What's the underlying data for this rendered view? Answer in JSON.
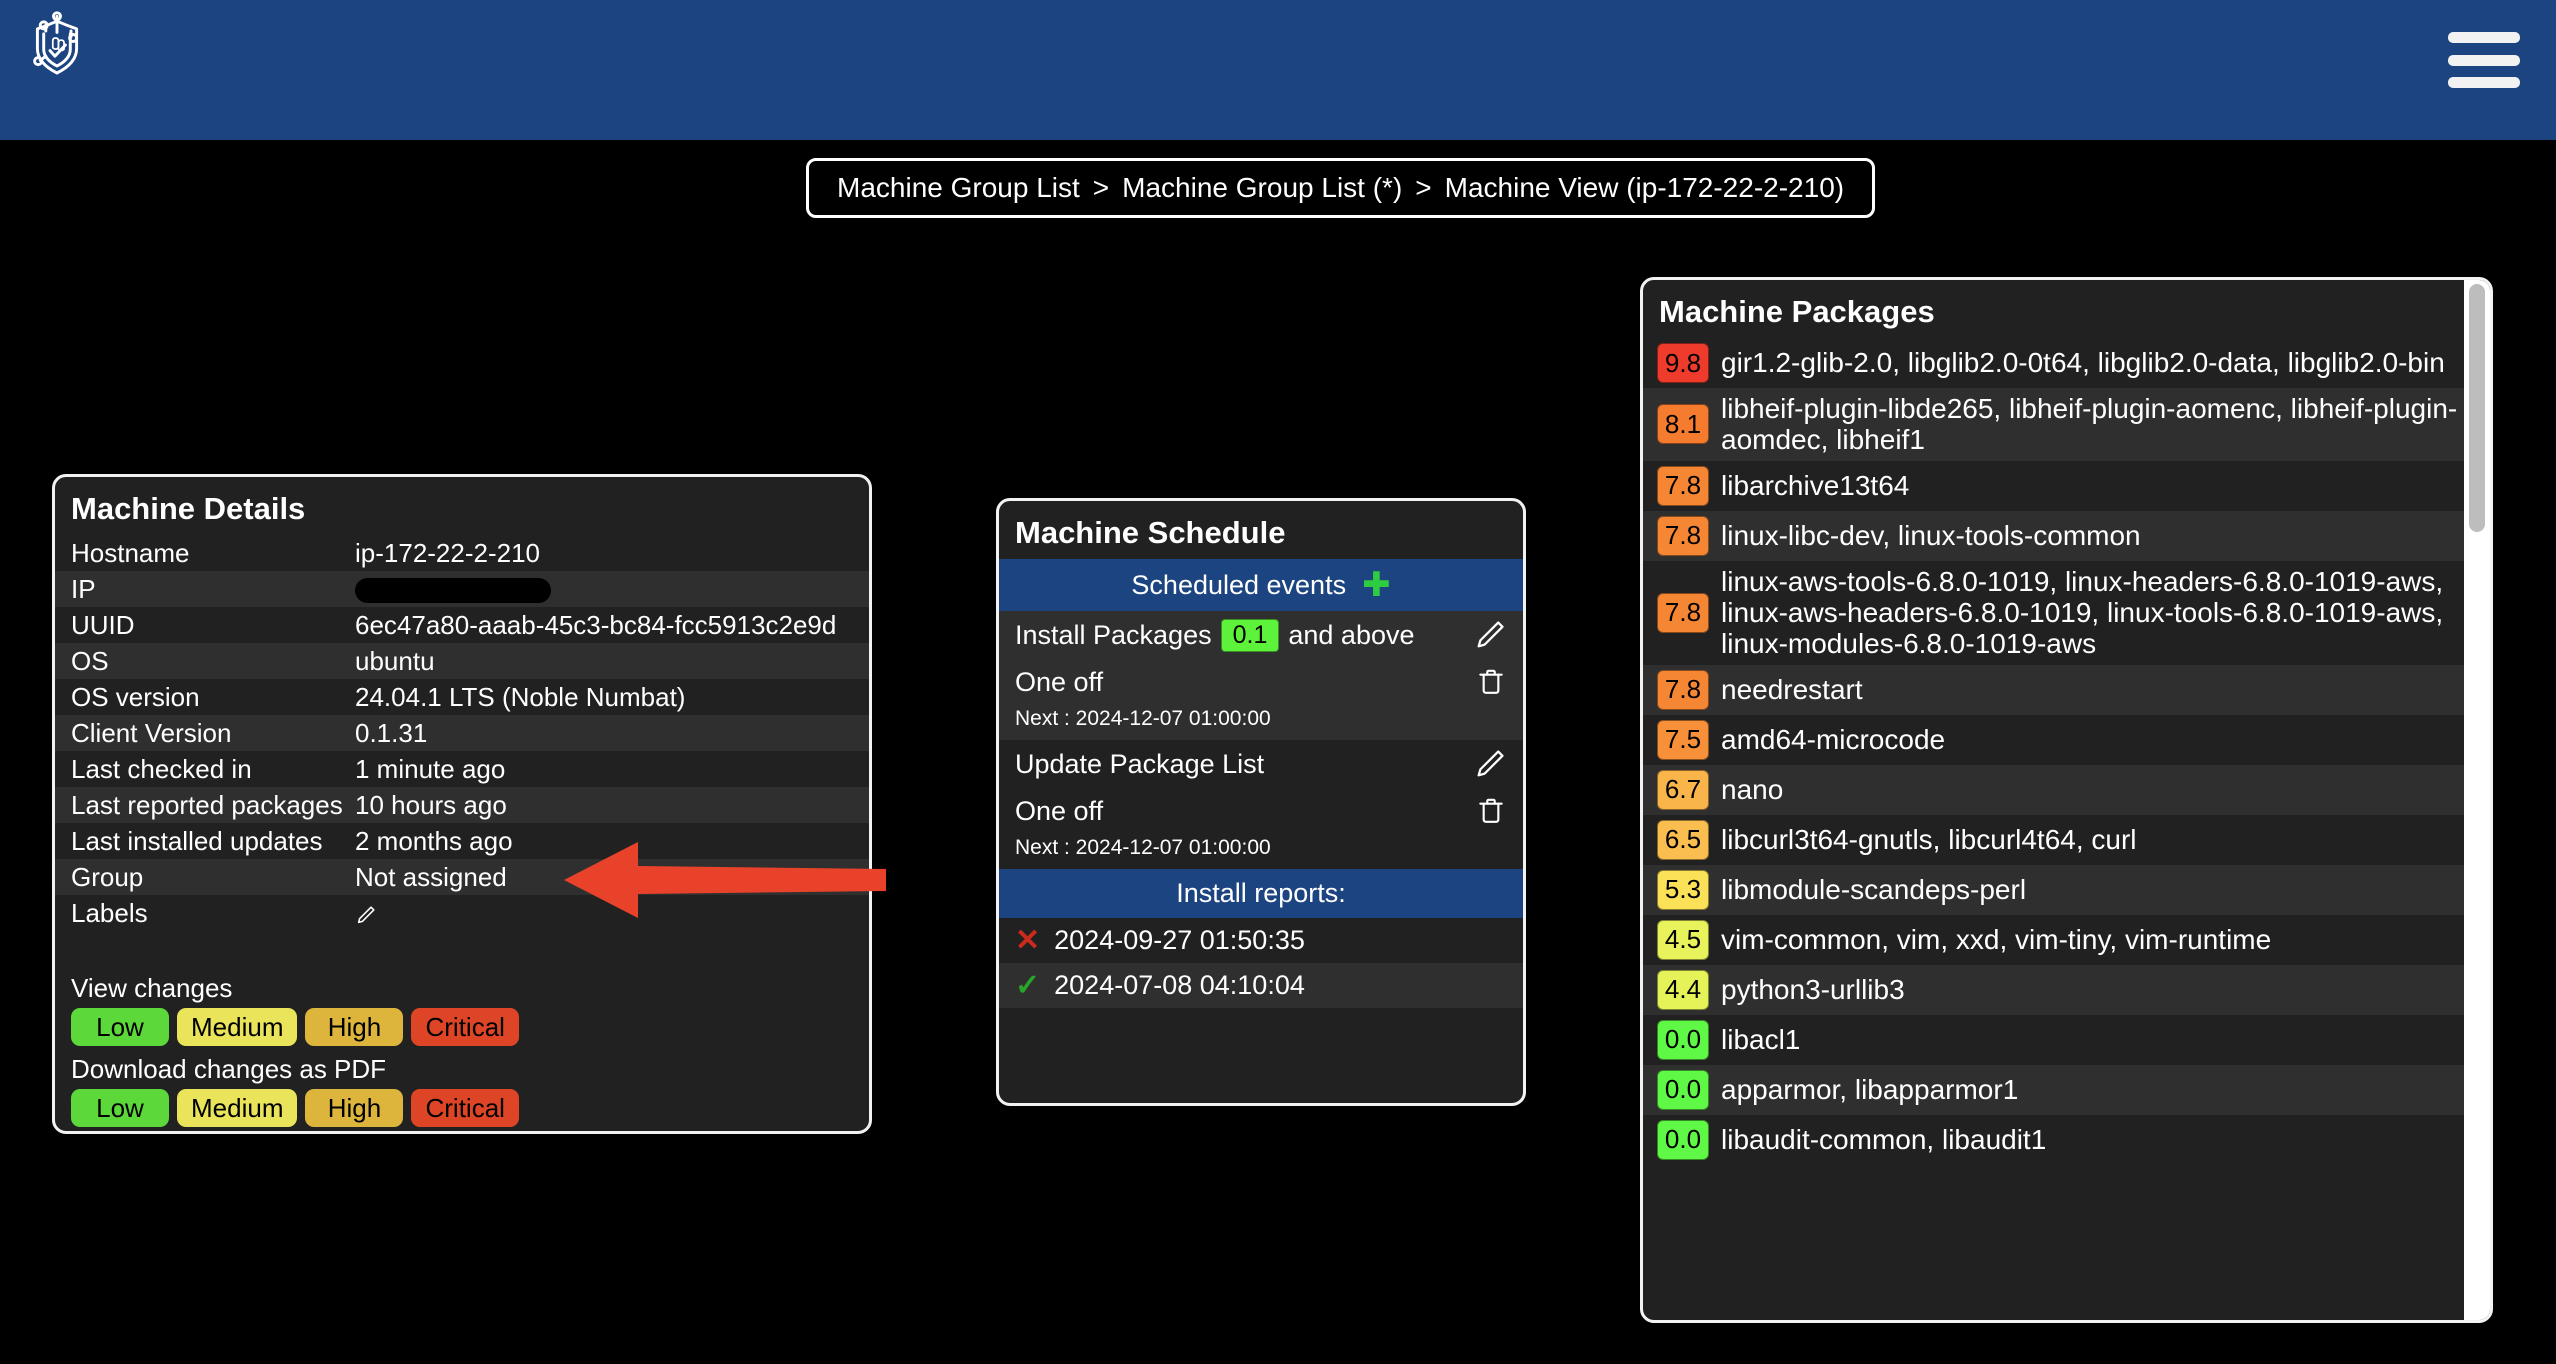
{
  "colors": {
    "header_blue": "#1c4480",
    "card_bg": "#212121",
    "row_alt": "#2f2f2f",
    "accent_red": "#e8432a",
    "green": "#5cf33a",
    "page_bg": "#000000"
  },
  "topbar": {
    "logo_name": "shield-circuit-logo",
    "menu_label": "menu"
  },
  "breadcrumb": {
    "items": [
      {
        "label": "Machine Group List"
      },
      {
        "label": "Machine Group List (*)"
      },
      {
        "label": "Machine View (ip-172-22-2-210)"
      }
    ],
    "separator": ">"
  },
  "machine_details": {
    "title": "Machine Details",
    "rows": [
      {
        "key": "Hostname",
        "value": "ip-172-22-2-210",
        "type": "text"
      },
      {
        "key": "IP",
        "value": "",
        "type": "redacted"
      },
      {
        "key": "UUID",
        "value": "6ec47a80-aaab-45c3-bc84-fcc5913c2e9d",
        "type": "text"
      },
      {
        "key": "OS",
        "value": "ubuntu",
        "type": "text"
      },
      {
        "key": "OS version",
        "value": "24.04.1 LTS (Noble Numbat)",
        "type": "text"
      },
      {
        "key": "Client Version",
        "value": "0.1.31",
        "type": "text"
      },
      {
        "key": "Last checked in",
        "value": "1 minute ago",
        "type": "text"
      },
      {
        "key": "Last reported packages",
        "value": "10 hours ago",
        "type": "text"
      },
      {
        "key": "Last installed updates",
        "value": "2 months ago",
        "type": "text"
      },
      {
        "key": "Group",
        "value": "Not assigned",
        "type": "text"
      },
      {
        "key": "Labels",
        "value": "",
        "type": "edit"
      }
    ],
    "view_changes_label": "View changes",
    "download_pdf_label": "Download changes as PDF",
    "severity_buttons": [
      {
        "label": "Low",
        "color": "#5cd83a"
      },
      {
        "label": "Medium",
        "color": "#e9e45a"
      },
      {
        "label": "High",
        "color": "#ddb53c"
      },
      {
        "label": "Critical",
        "color": "#de4526"
      }
    ]
  },
  "machine_schedule": {
    "title": "Machine Schedule",
    "scheduled_events_label": "Scheduled events",
    "add_icon": "plus-icon",
    "events": [
      {
        "name_prefix": "Install Packages",
        "threshold": "0.1",
        "name_suffix": "and above",
        "recurrence": "One off",
        "next": "Next : 2024-12-07 01:00:00",
        "edit_icon": "pencil-icon",
        "delete_icon": "trash-icon"
      },
      {
        "name_prefix": "Update Package List",
        "threshold": "",
        "name_suffix": "",
        "recurrence": "One off",
        "next": "Next : 2024-12-07 01:00:00",
        "edit_icon": "pencil-icon",
        "delete_icon": "trash-icon"
      }
    ],
    "install_reports_label": "Install reports:",
    "reports": [
      {
        "status": "fail",
        "mark": "✕",
        "timestamp": "2024-09-27 01:50:35"
      },
      {
        "status": "ok",
        "mark": "✓",
        "timestamp": "2024-07-08 04:10:04"
      }
    ]
  },
  "machine_packages": {
    "title": "Machine Packages",
    "scrollbar": {
      "thumb_top_pct": 0.4,
      "thumb_height_pct": 24
    },
    "rows": [
      {
        "score": "9.8",
        "color": "#ef3b2c",
        "packages": "gir1.2-glib-2.0, libglib2.0-0t64, libglib2.0-data, libglib2.0-bin"
      },
      {
        "score": "8.1",
        "color": "#f57c2e",
        "packages": "libheif-plugin-libde265, libheif-plugin-aomenc, libheif-plugin-aomdec, libheif1"
      },
      {
        "score": "7.8",
        "color": "#f58634",
        "packages": "libarchive13t64"
      },
      {
        "score": "7.8",
        "color": "#f58634",
        "packages": "linux-libc-dev, linux-tools-common"
      },
      {
        "score": "7.8",
        "color": "#f58634",
        "packages": "linux-aws-tools-6.8.0-1019, linux-headers-6.8.0-1019-aws, linux-aws-headers-6.8.0-1019, linux-tools-6.8.0-1019-aws, linux-modules-6.8.0-1019-aws"
      },
      {
        "score": "7.8",
        "color": "#f58634",
        "packages": "needrestart"
      },
      {
        "score": "7.5",
        "color": "#f79039",
        "packages": "amd64-microcode"
      },
      {
        "score": "6.7",
        "color": "#f9b44a",
        "packages": "nano"
      },
      {
        "score": "6.5",
        "color": "#fabd4f",
        "packages": "libcurl3t64-gnutls, libcurl4t64, curl"
      },
      {
        "score": "5.3",
        "color": "#fbe158",
        "packages": "libmodule-scandeps-perl"
      },
      {
        "score": "4.5",
        "color": "#e8f25a",
        "packages": "vim-common, vim, xxd, vim-tiny, vim-runtime"
      },
      {
        "score": "4.4",
        "color": "#e5f258",
        "packages": "python3-urllib3"
      },
      {
        "score": "0.0",
        "color": "#60f846",
        "packages": "libacl1"
      },
      {
        "score": "0.0",
        "color": "#60f846",
        "packages": "apparmor, libapparmor1"
      },
      {
        "score": "0.0",
        "color": "#60f846",
        "packages": "libaudit-common, libaudit1"
      }
    ]
  },
  "annotation": {
    "arrow_name": "callout-arrow-to-group-row",
    "color": "#e8432a",
    "direction": "left"
  }
}
